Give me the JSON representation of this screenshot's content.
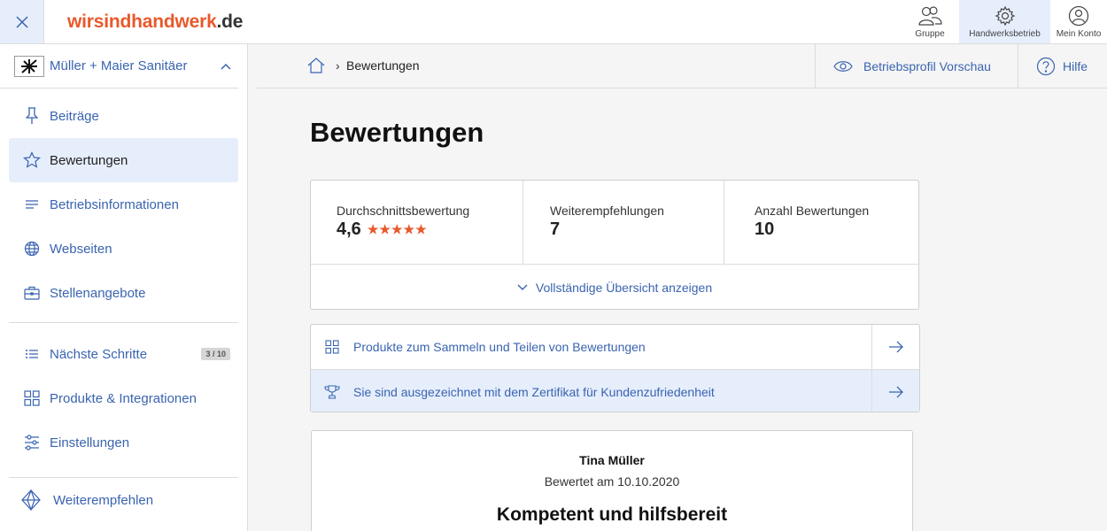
{
  "brand": {
    "logo_part1": "wir",
    "logo_part2": "sindhandwerk",
    "logo_part3": ".de",
    "accent_color": "#e8592b",
    "link_color": "#3a64b0"
  },
  "top_nav": {
    "group_label": "Gruppe",
    "business_label": "Handwerksbetrieb",
    "account_label": "Mein Konto"
  },
  "sidebar": {
    "company_name": "Müller + Maier Sanitäer",
    "items": [
      {
        "label": "Beiträge",
        "icon": "pin-icon"
      },
      {
        "label": "Bewertungen",
        "icon": "star-icon"
      },
      {
        "label": "Betriebsinformationen",
        "icon": "lines-icon"
      },
      {
        "label": "Webseiten",
        "icon": "globe-icon"
      },
      {
        "label": "Stellenangebote",
        "icon": "briefcase-icon"
      }
    ],
    "items2": [
      {
        "label": "Nächste Schritte",
        "icon": "list-icon",
        "badge": "3 / 10"
      },
      {
        "label": "Produkte & Integrationen",
        "icon": "grid-icon"
      },
      {
        "label": "Einstellungen",
        "icon": "sliders-icon"
      }
    ],
    "recommend_label": "Weiterempfehlen"
  },
  "breadcrumb": {
    "separator": "›",
    "current": "Bewertungen",
    "preview_label": "Betriebsprofil Vorschau",
    "help_label": "Hilfe"
  },
  "main": {
    "title": "Bewertungen",
    "stats": {
      "avg_label": "Durchschnittsbewertung",
      "avg_value": "4,6",
      "avg_stars": 5,
      "recommend_label": "Weiterempfehlungen",
      "recommend_value": "7",
      "count_label": "Anzahl Bewertungen",
      "count_value": "10",
      "expand_label": "Vollständige Übersicht anzeigen"
    },
    "links": [
      {
        "label": "Produkte zum Sammeln und Teilen von Bewertungen",
        "icon": "grid-icon"
      },
      {
        "label": "Sie sind ausgezeichnet mit dem Zertifikat für Kundenzufriedenheit",
        "icon": "trophy-icon"
      }
    ],
    "review": {
      "author": "Tina Müller",
      "date": "Bewertet am 10.10.2020",
      "headline": "Kompetent und hilfsbereit"
    }
  }
}
